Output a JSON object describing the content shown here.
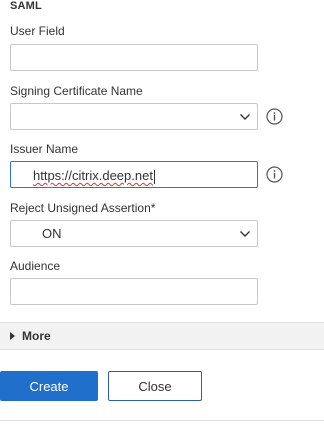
{
  "section": {
    "title": "SAML"
  },
  "fields": {
    "user_field": {
      "label": "User Field",
      "value": ""
    },
    "signing_certificate_name": {
      "label": "Signing Certificate Name",
      "value": ""
    },
    "issuer_name": {
      "label": "Issuer Name",
      "value": "https://citrix.deep.net"
    },
    "reject_unsigned_assertion": {
      "label": "Reject Unsigned Assertion*",
      "value": "ON"
    },
    "audience": {
      "label": "Audience",
      "value": ""
    }
  },
  "more": {
    "label": "More"
  },
  "footer": {
    "create_label": "Create",
    "close_label": "Close"
  },
  "colors": {
    "primary": "#1f6fcb",
    "focus_border": "#2e74c9",
    "border": "#c8c8c8",
    "more_bar": "#f2f2f2"
  },
  "icons": {
    "info": "info-circle-icon",
    "chevron": "chevron-down-icon",
    "expand": "caret-right-icon"
  }
}
